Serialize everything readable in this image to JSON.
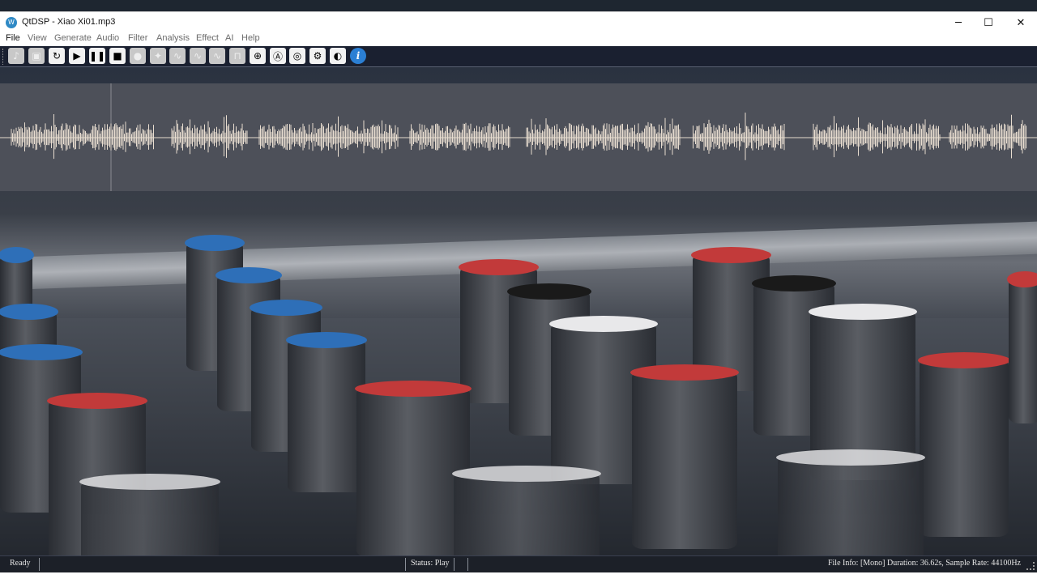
{
  "window": {
    "title": "QtDSP - Xiao Xi01.mp3",
    "app_icon_glyph": "W"
  },
  "menubar": {
    "items": [
      "File",
      "View",
      "Generate",
      "Audio",
      "Filter",
      "Analysis",
      "Effect",
      "AI",
      "Help"
    ]
  },
  "toolbar": {
    "buttons": [
      {
        "name": "open-file-button",
        "icon": "music-file-icon",
        "glyph": "♪",
        "style": "gray"
      },
      {
        "name": "save-button",
        "icon": "save-icon",
        "glyph": "▣",
        "style": "gray"
      },
      {
        "name": "reload-button",
        "icon": "reload-icon",
        "glyph": "↻",
        "style": "white"
      },
      {
        "name": "play-button",
        "icon": "play-icon",
        "glyph": "▶",
        "style": "white"
      },
      {
        "name": "pause-button",
        "icon": "pause-icon",
        "glyph": "❚❚",
        "style": "white"
      },
      {
        "name": "stop-button",
        "icon": "stop-icon",
        "glyph": "■",
        "style": "white"
      },
      {
        "name": "record-button",
        "icon": "microphone-icon",
        "glyph": "●",
        "style": "gray"
      },
      {
        "name": "generate-button",
        "icon": "wand-icon",
        "glyph": "✦",
        "style": "gray"
      },
      {
        "name": "filter-lowpass-button",
        "icon": "wave-icon",
        "glyph": "∿",
        "style": "gray"
      },
      {
        "name": "filter-highpass-button",
        "icon": "wave-icon",
        "glyph": "∿",
        "style": "gray"
      },
      {
        "name": "filter-bandpass-button",
        "icon": "wave-icon",
        "glyph": "∿",
        "style": "gray"
      },
      {
        "name": "filter-bandstop-button",
        "icon": "wave-icon",
        "glyph": "⊓",
        "style": "gray"
      },
      {
        "name": "analysis-button",
        "icon": "scope-icon",
        "glyph": "⊕",
        "style": "white"
      },
      {
        "name": "ai-button",
        "icon": "letter-a-icon",
        "glyph": "Ⓐ",
        "style": "white"
      },
      {
        "name": "effect-button",
        "icon": "effect-icon",
        "glyph": "◎",
        "style": "white"
      },
      {
        "name": "settings-button",
        "icon": "gear-icon",
        "glyph": "⚙",
        "style": "white"
      },
      {
        "name": "volume-button",
        "icon": "volume-icon",
        "glyph": "◐",
        "style": "white"
      },
      {
        "name": "info-button",
        "icon": "info-icon",
        "glyph": "i",
        "style": "info"
      }
    ]
  },
  "colors": {
    "waveform_bg": "#4d5059",
    "waveform_line": "#e8ddd0",
    "status_bg": "#1c2028"
  },
  "statusbar": {
    "ready": "Ready",
    "status": "Status: Play",
    "file_info": "File Info: [Mono] Duration: 36.62s, Sample Rate: 44100Hz"
  }
}
